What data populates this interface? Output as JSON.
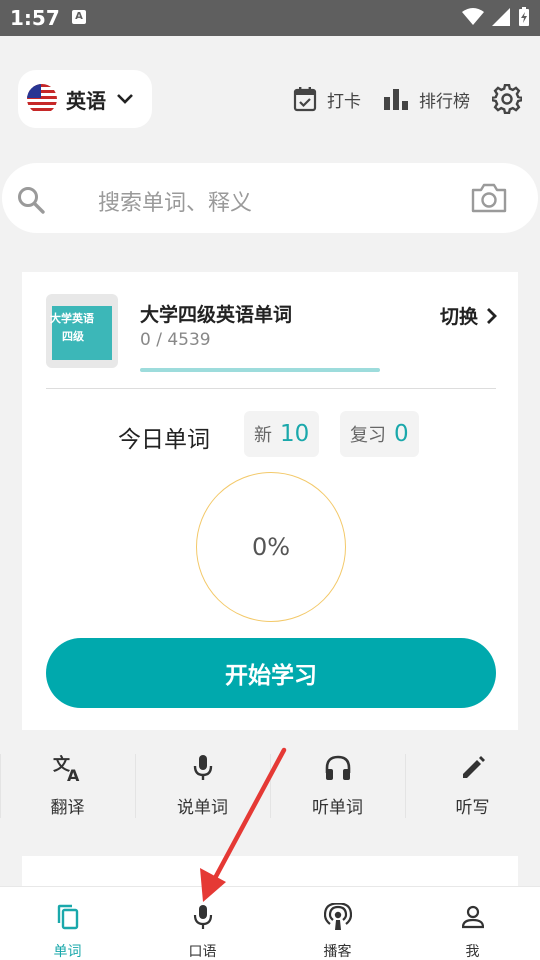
{
  "status_bar": {
    "time": "1:57",
    "notification_letter": "A"
  },
  "header": {
    "language": "英语",
    "checkin_label": "打卡",
    "ranking_label": "排行榜"
  },
  "search": {
    "placeholder": "搜索单词、释义"
  },
  "book": {
    "cover_line1": "大学英语",
    "cover_line2": "四级",
    "title": "大学四级英语单词",
    "progress": "0 / 4539",
    "switch_label": "切换"
  },
  "today": {
    "label": "今日单词",
    "new_label": "新",
    "new_count": "10",
    "review_label": "复习",
    "review_count": "0",
    "percent": "0%"
  },
  "start_button": "开始学习",
  "tools": [
    {
      "label": "翻译",
      "icon": "translate-icon"
    },
    {
      "label": "说单词",
      "icon": "microphone-icon"
    },
    {
      "label": "听单词",
      "icon": "headphones-icon"
    },
    {
      "label": "听写",
      "icon": "pencil-icon"
    }
  ],
  "bottom_nav": [
    {
      "label": "单词",
      "icon": "copy-icon",
      "active": true
    },
    {
      "label": "口语",
      "icon": "microphone-icon",
      "active": false
    },
    {
      "label": "播客",
      "icon": "podcast-icon",
      "active": false
    },
    {
      "label": "我",
      "icon": "person-icon",
      "active": false
    }
  ],
  "colors": {
    "accent": "#00a9ad",
    "ring": "#f3c96a",
    "annotation": "#e53935"
  }
}
